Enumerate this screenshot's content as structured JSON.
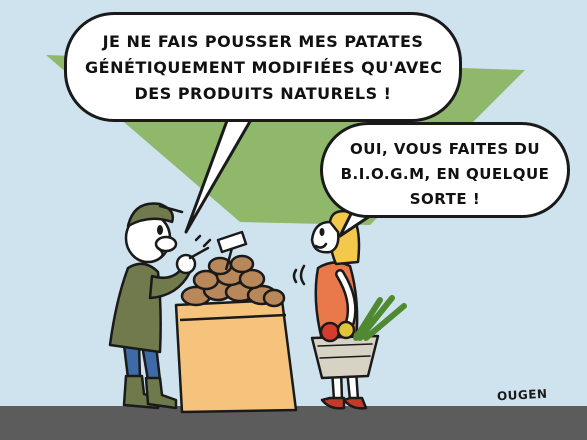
{
  "speech": {
    "farmer": {
      "lines": [
        "JE NE FAIS POUSSER MES PATATES",
        "GÉNÉTIQUEMENT MODIFIÉES QU'AVEC",
        "DES PRODUITS NATURELS !"
      ]
    },
    "woman": {
      "lines": [
        "OUI, VOUS FAITES DU",
        "B.I.O.G.M, EN QUELQUE",
        "SORTE !"
      ]
    }
  },
  "signature": "OUGEN",
  "colors": {
    "sky": "#cfe3ef",
    "green_shape": "#8fb86a",
    "ground": "#5c5c5c",
    "crate": "#f6c37c",
    "farmer_jacket": "#707a4c",
    "woman_dress": "#e9784a",
    "woman_hair": "#f4c84a",
    "potato": "#b8875a"
  }
}
